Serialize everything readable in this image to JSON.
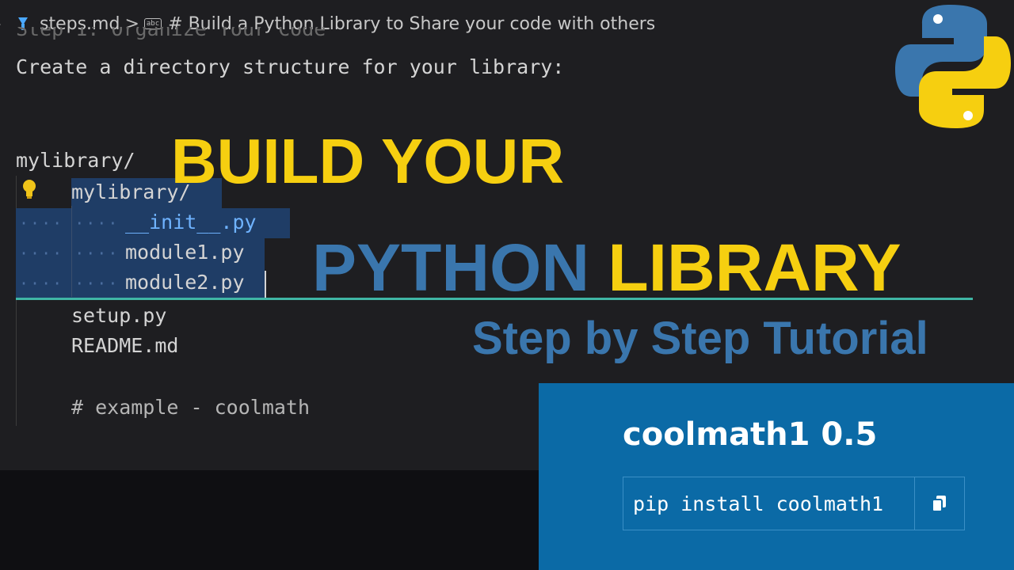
{
  "breadcrumb": {
    "file": "steps.md",
    "separator": ">",
    "heading": "# Build a Python Library to Share your code with others"
  },
  "editor": {
    "ghost_line": "Step 1: Organize Your Code",
    "line_intro": "Create a directory structure for your library:",
    "line_root": "mylibrary/",
    "line_pkg": "mylibrary/",
    "line_init": "__init__.py",
    "line_mod1": "module1.py",
    "line_mod2": "module2.py",
    "line_setup": "setup.py",
    "line_readme": "README.md",
    "line_comment": "# example - coolmath"
  },
  "overlay": {
    "build_your": "BUILD YOUR",
    "python": "PYTHON",
    "library": "LIBRARY",
    "subtitle": "Step by Step Tutorial"
  },
  "pypi": {
    "package": "coolmath1 0.5",
    "pip_command": "pip install coolmath1"
  },
  "colors": {
    "yellow": "#f6cf10",
    "blue": "#3a76ad",
    "pypi_blue": "#0b6aa6",
    "selection": "#1f3d66",
    "accent_line": "#3fb6a5"
  }
}
